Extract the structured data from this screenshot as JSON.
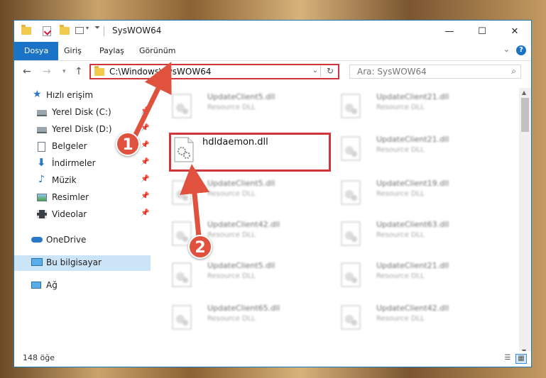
{
  "window": {
    "title": "SysWOW64",
    "controls": {
      "minimize": "—",
      "maximize": "☐",
      "close": "✕"
    }
  },
  "ribbon": {
    "tabs": [
      "Dosya",
      "Giriş",
      "Paylaş",
      "Görünüm"
    ],
    "help": "?"
  },
  "address_bar": {
    "path": "C:\\Windows\\SysWOW64",
    "search_placeholder": "Ara: SysWOW64"
  },
  "sidebar": {
    "items": [
      {
        "label": "Hızlı erişim",
        "icon": "star-icon"
      },
      {
        "label": "Yerel Disk (C:)",
        "icon": "drive-icon",
        "pinned": true
      },
      {
        "label": "Yerel Disk (D:)",
        "icon": "drive-icon",
        "pinned": true
      },
      {
        "label": "Belgeler",
        "icon": "document-icon",
        "pinned": true
      },
      {
        "label": "İndirmeler",
        "icon": "download-icon",
        "pinned": true
      },
      {
        "label": "Müzik",
        "icon": "music-icon",
        "pinned": true
      },
      {
        "label": "Resimler",
        "icon": "picture-icon",
        "pinned": true
      },
      {
        "label": "Videolar",
        "icon": "video-icon",
        "pinned": true
      },
      {
        "label": "OneDrive",
        "icon": "cloud-icon"
      },
      {
        "label": "Bu bilgisayar",
        "icon": "computer-icon",
        "selected": true
      },
      {
        "label": "Ağ",
        "icon": "network-icon"
      }
    ]
  },
  "files": {
    "highlighted": {
      "name": "hdldaemon.dll"
    },
    "left_column": [
      {
        "name": "UpdateClient5.dll",
        "type": "Resource DLL"
      },
      {
        "name": "UpdateClient5.dll",
        "type": "Resource DLL"
      },
      {
        "name": "UpdateClient42.dll",
        "type": "Resource DLL"
      },
      {
        "name": "UpdateClient5.dll",
        "type": "Resource DLL"
      },
      {
        "name": "UpdateClient65.dll",
        "type": "Resource DLL"
      }
    ],
    "right_column": [
      {
        "name": "UpdateClient21.dll",
        "type": "Resource DLL"
      },
      {
        "name": "UpdateClient21.dll",
        "type": "Resource DLL"
      },
      {
        "name": "UpdateClient19.dll",
        "type": "Resource DLL"
      },
      {
        "name": "UpdateClient63.dll",
        "type": "Resource DLL"
      },
      {
        "name": "UpdateClient21.dll",
        "type": "Resource DLL"
      },
      {
        "name": "UpdateClient42.dll",
        "type": "Resource DLL"
      }
    ]
  },
  "status": {
    "count": "148 öğe"
  },
  "annotations": {
    "marker1": "1",
    "marker2": "2",
    "color": "#e0523d"
  }
}
